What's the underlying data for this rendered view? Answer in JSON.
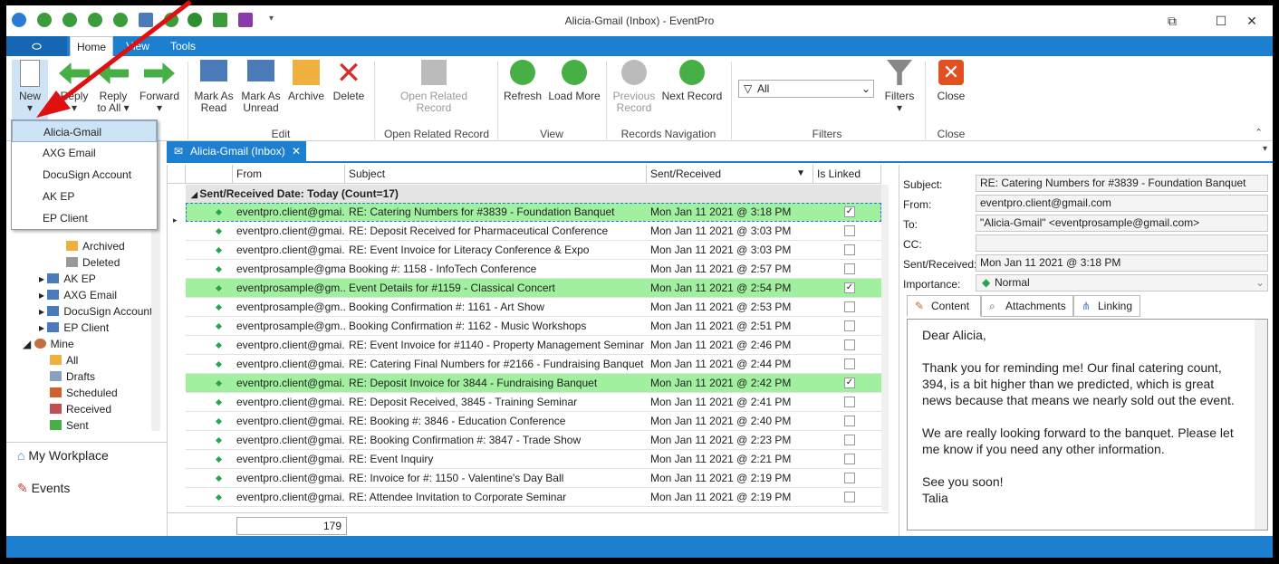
{
  "window": {
    "title": "Alicia-Gmail (Inbox) - EventPro"
  },
  "ribbon_tabs": [
    "Home",
    "View",
    "Tools"
  ],
  "ribbon_buttons": {
    "new": "New",
    "reply": "Reply",
    "reply_all_1": "Reply",
    "reply_all_2": "to All",
    "forward": "Forward",
    "mark_read_1": "Mark As",
    "mark_read_2": "Read",
    "mark_unread_1": "Mark As",
    "mark_unread_2": "Unread",
    "archive": "Archive",
    "delete": "Delete",
    "open_related_1": "Open Related",
    "open_related_2": "Record",
    "refresh": "Refresh",
    "load_more": "Load More",
    "prev_1": "Previous",
    "prev_2": "Record",
    "next": "Next Record",
    "filters": "Filters",
    "close": "Close"
  },
  "ribbon_groups": {
    "edit": "Edit",
    "open_related": "Open Related Record",
    "view": "View",
    "records_nav": "Records Navigation",
    "filters": "Filters",
    "close": "Close"
  },
  "filter_value": "All",
  "new_menu": [
    "Alicia-Gmail",
    "AXG Email",
    "DocuSign Account",
    "AK EP",
    "EP Client"
  ],
  "tree": {
    "archived": "Archived",
    "deleted": "Deleted",
    "ak_ep": "AK EP",
    "axg": "AXG Email",
    "docusign": "DocuSign Account",
    "ep_client": "EP Client",
    "mine": "Mine",
    "all": "All",
    "drafts": "Drafts",
    "scheduled": "Scheduled",
    "received": "Received",
    "sent": "Sent"
  },
  "nav": {
    "workplace": "My Workplace",
    "events": "Events"
  },
  "doc_tab": "Alicia-Gmail (Inbox)",
  "grid": {
    "headers": {
      "from": "From",
      "subject": "Subject",
      "sent": "Sent/Received",
      "linked": "Is Linked"
    },
    "group": "Sent/Received Date: Today (Count=17)",
    "rows": [
      {
        "from": "eventpro.client@gmai...",
        "subject": "RE: Catering Numbers for #3839 - Foundation Banquet",
        "sent": "Mon Jan 11 2021 @ 3:18 PM",
        "linked": "✓"
      },
      {
        "from": "eventpro.client@gmai...",
        "subject": "RE: Deposit Received for Pharmaceutical Conference",
        "sent": "Mon Jan 11 2021 @ 3:03 PM",
        "linked": ""
      },
      {
        "from": "eventpro.client@gmai...",
        "subject": "RE: Event Invoice for Literacy Conference & Expo",
        "sent": "Mon Jan 11 2021 @ 3:03 PM",
        "linked": ""
      },
      {
        "from": "eventprosample@gma...",
        "subject": "Booking #: 1158 - InfoTech Conference",
        "sent": "Mon Jan 11 2021 @ 2:57 PM",
        "linked": ""
      },
      {
        "from": "eventprosample@gm...",
        "subject": "Event Details for #1159 - Classical Concert",
        "sent": "Mon Jan 11 2021 @ 2:54 PM",
        "linked": "✓"
      },
      {
        "from": "eventprosample@gm...",
        "subject": "Booking Confirmation #: 1161 - Art Show",
        "sent": "Mon Jan 11 2021 @ 2:53 PM",
        "linked": ""
      },
      {
        "from": "eventprosample@gm...",
        "subject": "Booking Confirmation #: 1162 - Music Workshops",
        "sent": "Mon Jan 11 2021 @ 2:51 PM",
        "linked": ""
      },
      {
        "from": "eventpro.client@gmai...",
        "subject": "RE: Event Invoice for #1140 - Property Management Seminar",
        "sent": "Mon Jan 11 2021 @ 2:46 PM",
        "linked": ""
      },
      {
        "from": "eventpro.client@gmai...",
        "subject": "RE: Catering Final Numbers for #2166 - Fundraising Banquet",
        "sent": "Mon Jan 11 2021 @ 2:44 PM",
        "linked": ""
      },
      {
        "from": "eventpro.client@gmai...",
        "subject": "RE: Deposit Invoice for 3844 - Fundraising Banquet",
        "sent": "Mon Jan 11 2021 @ 2:42 PM",
        "linked": "✓"
      },
      {
        "from": "eventpro.client@gmai...",
        "subject": "RE: Deposit Received, 3845 - Training Seminar",
        "sent": "Mon Jan 11 2021 @ 2:41 PM",
        "linked": ""
      },
      {
        "from": "eventpro.client@gmai...",
        "subject": "RE: Booking #: 3846 - Education Conference",
        "sent": "Mon Jan 11 2021 @ 2:40 PM",
        "linked": ""
      },
      {
        "from": "eventpro.client@gmai...",
        "subject": "RE: Booking Confirmation #: 3847 - Trade Show",
        "sent": "Mon Jan 11 2021 @ 2:23 PM",
        "linked": ""
      },
      {
        "from": "eventpro.client@gmai...",
        "subject": "RE: Event Inquiry",
        "sent": "Mon Jan 11 2021 @ 2:21 PM",
        "linked": ""
      },
      {
        "from": "eventpro.client@gmai...",
        "subject": "RE: Invoice for #: 1150 - Valentine's Day Ball",
        "sent": "Mon Jan 11 2021 @ 2:19 PM",
        "linked": ""
      },
      {
        "from": "eventpro.client@gmai...",
        "subject": "RE: Attendee Invitation to Corporate Seminar",
        "sent": "Mon Jan 11 2021 @ 2:19 PM",
        "linked": ""
      }
    ],
    "count": "179"
  },
  "detail": {
    "subject_label": "Subject:",
    "subject": "RE: Catering Numbers for #3839 - Foundation Banquet",
    "from_label": "From:",
    "from": "eventpro.client@gmail.com",
    "to_label": "To:",
    "to": "\"Alicia-Gmail\" <eventprosample@gmail.com>",
    "cc_label": "CC:",
    "cc": "",
    "sent_label": "Sent/Received:",
    "sent": "Mon Jan 11 2021 @ 3:18 PM",
    "importance_label": "Importance:",
    "importance": "Normal",
    "tabs": [
      "Content",
      "Attachments",
      "Linking"
    ],
    "body": {
      "greeting": "Dear Alicia,",
      "p1": "Thank you for reminding me! Our final catering count, 394, is a bit higher than we predicted, which is great news because that means we nearly sold out the event.",
      "p2": "We are really looking forward to the banquet.  Please let me know if you need any other information.",
      "p3": "See you soon!",
      "sig": "Talia"
    }
  },
  "colors": {
    "accent": "#1c7fd0",
    "linked_row": "#a0f0a0",
    "arrow": "#e01010"
  }
}
